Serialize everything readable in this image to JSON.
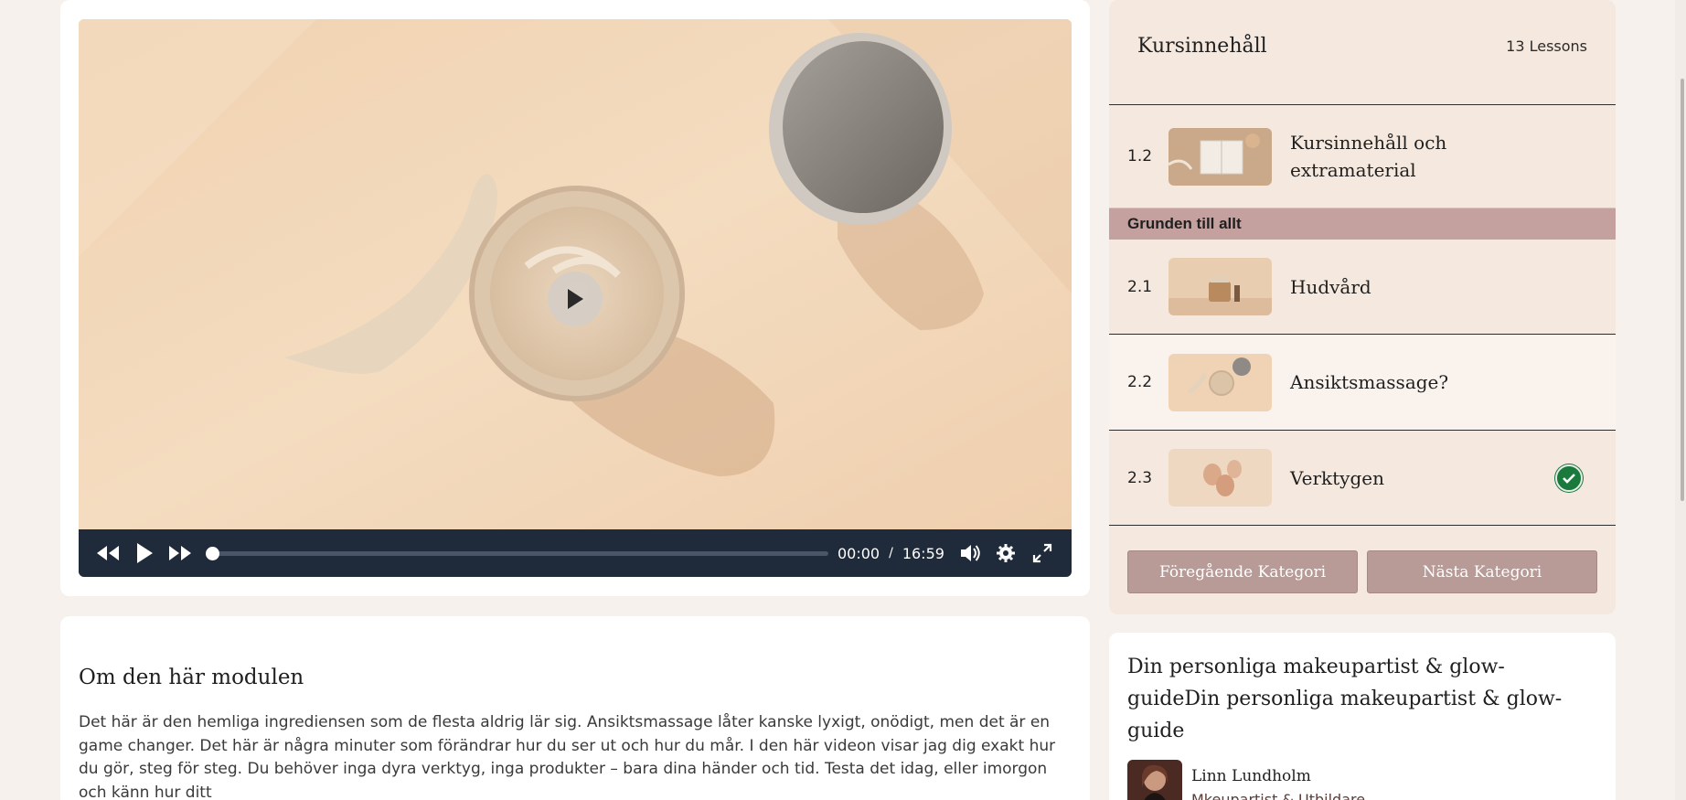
{
  "video": {
    "current_time": "00:00",
    "separator": "/",
    "duration": "16:59",
    "progress": 0
  },
  "about": {
    "title": "Om den här modulen",
    "text": "Det här är den hemliga ingrediensen som de flesta aldrig lär sig. Ansiktsmassage låter kanske lyxigt, onödigt, men det är en game changer. Det här är några minuter som förändrar hur du ser ut och hur du mår. I den här videon visar jag dig exakt hur du gör, steg för steg. Du behöver inga dyra verktyg, inga produkter – bara dina händer och tid. Testa det idag, eller imorgon och känn hur ditt"
  },
  "sidebar": {
    "title": "Kursinnehåll",
    "lesson_count": "13 Lessons",
    "lessons": [
      {
        "num": "1.2",
        "title": "Kursinnehåll och extramaterial",
        "thumb_icon": "notebook-thumbnail",
        "completed": false
      },
      {
        "num": "2.1",
        "title": "Hudvård",
        "thumb_icon": "skincare-jar-thumbnail",
        "completed": false
      },
      {
        "num": "2.2",
        "title": "Ansiktsmassage?",
        "thumb_icon": "cream-jar-thumbnail",
        "completed": false
      },
      {
        "num": "2.3",
        "title": "Verktygen",
        "thumb_icon": "sponges-thumbnail",
        "completed": true
      }
    ],
    "category": "Grunden till allt",
    "prev_button": "Föregående Kategori",
    "next_button": "Nästa Kategori"
  },
  "guide": {
    "title": "Din personliga makeupartist & glow-guideDin personliga makeupartist & glow-guide",
    "author_name": "Linn Lundholm",
    "author_role": "Mkeupartist & Utbildare"
  },
  "colors": {
    "accent_category": "#c4a09f",
    "nav_button": "#b89a97",
    "controls_bg": "#1f2a3a",
    "check_green": "#1a7a3c"
  }
}
